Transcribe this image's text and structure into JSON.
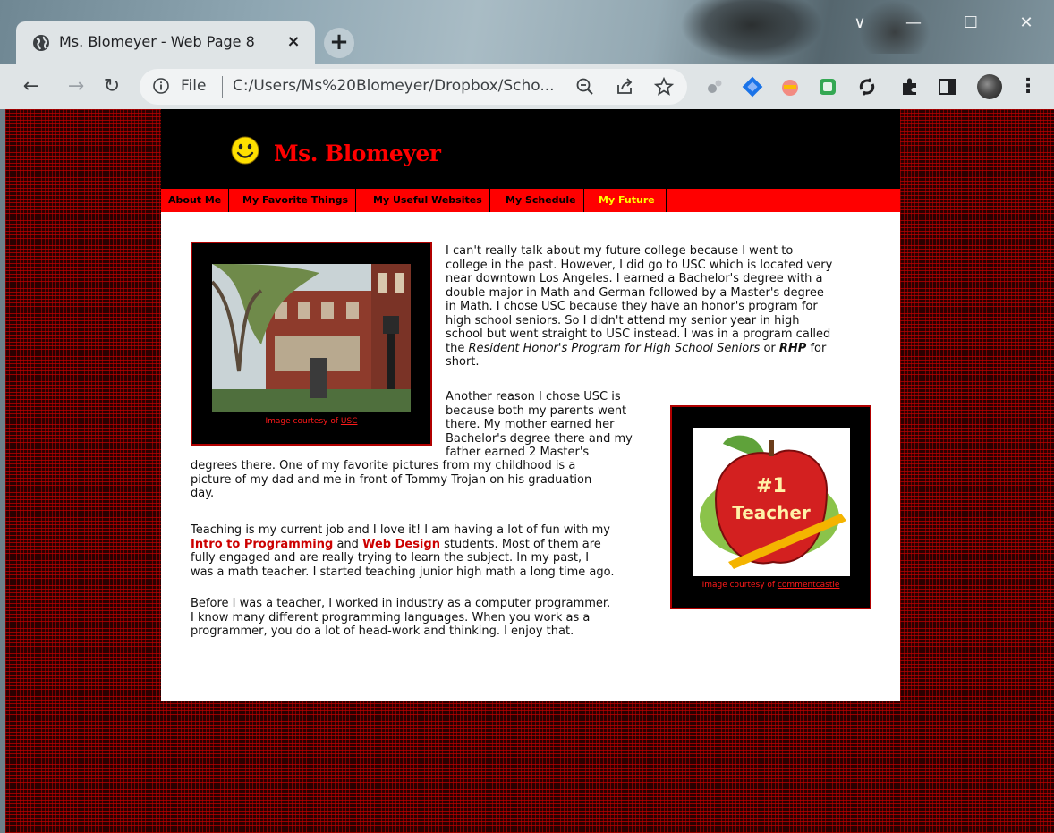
{
  "browser": {
    "tab_title": "Ms. Blomeyer - Web Page 8",
    "tab_close": "×",
    "new_tab": "+",
    "window_controls": {
      "minimize": "—",
      "maximize": "☐",
      "close": "✕",
      "chevron": "∨"
    },
    "nav": {
      "back": "←",
      "forward": "→",
      "reload": "↻"
    },
    "omnibox": {
      "scheme": "File",
      "url": "C:/Users/Ms%20Blomeyer/Dropbox/Scho..."
    },
    "menu": "⋮"
  },
  "site": {
    "name": "Ms. Blomeyer",
    "nav": [
      {
        "label": "About Me"
      },
      {
        "label": "My Favorite Things"
      },
      {
        "label": "My Useful Websites"
      },
      {
        "label": "My Schedule"
      },
      {
        "label": "My Future",
        "active": true
      }
    ]
  },
  "figures": {
    "usc": {
      "caption_prefix": "Image courtesy of ",
      "caption_link": "USC"
    },
    "teacher": {
      "caption_prefix": "Image courtesy of ",
      "caption_link": "commentcastle",
      "image_text_1": "#1",
      "image_text_2": "Teacher"
    }
  },
  "content": {
    "p1": [
      "I can't really talk about my future college because I went to",
      "college in the past. However, I did go to USC which is located very",
      "near downtown Los Angeles. I earned a Bachelor's degree with a",
      "double major in Math and German followed by a Master's degree",
      "in Math. I chose USC because they have an honor's program for",
      "high school seniors. So I didn't attend my senior year in high",
      "school but went straight to USC instead. I was in a program called"
    ],
    "p1_last_a": "the ",
    "p1_last_em": "Resident Honor's Program for High School Seniors",
    "p1_last_b": " or ",
    "p1_last_strong": "RHP",
    "p1_last_c": " for",
    "p1_end": "short.",
    "p2": [
      "Another reason I chose USC is",
      "because both my parents went",
      "there. My mother earned her",
      "Bachelor's degree there and my",
      "father earned 2 Master's",
      "degrees there. One of my favorite pictures from my childhood is a",
      "picture of my dad and me in front of Tommy Trojan on his graduation",
      "day."
    ],
    "p3_line1": "Teaching is my current job and I love it! I am having a lot of fun with my",
    "p3_link1": "Intro to Programming",
    "p3_and": " and ",
    "p3_link2": "Web Design",
    "p3_line2_rest": " students. Most of them are",
    "p3_rest": [
      "fully engaged and are really trying to learn the subject. In my past, I",
      "was a math teacher. I started teaching junior high math a long time ago."
    ],
    "p4": [
      "Before I was a teacher, I worked in industry as a computer programmer.",
      "I know many different programming languages. When you work as a",
      "programmer, you do a lot of head-work and thinking. I enjoy that."
    ]
  },
  "colors": {
    "accent": "#ff0000",
    "nav_active": "#ffff00",
    "header_bg": "#000000"
  }
}
